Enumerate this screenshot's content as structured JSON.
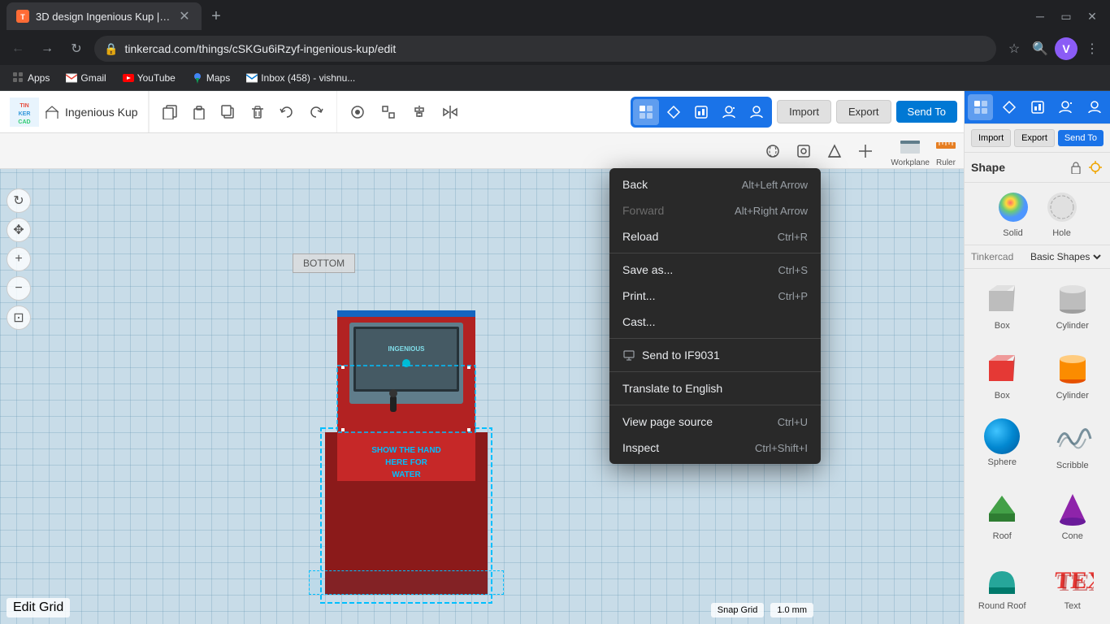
{
  "browser": {
    "tab": {
      "title": "3D design Ingenious Kup | Tinker...",
      "favicon": "🎨"
    },
    "url": "tinkercad.com/things/cSKGu6iRzyf-ingenious-kup/edit",
    "bookmarks": [
      {
        "label": "Apps",
        "icon": "grid"
      },
      {
        "label": "Gmail",
        "icon": "mail"
      },
      {
        "label": "YouTube",
        "icon": "youtube"
      },
      {
        "label": "Maps",
        "icon": "map"
      },
      {
        "label": "Inbox (458) - vishnu...",
        "icon": "mail"
      }
    ]
  },
  "tinkercad": {
    "project_name": "Ingenious Kup",
    "logo_letters": [
      "TIN",
      "KER",
      "CAD"
    ],
    "toolbar": {
      "copy_label": "Copy",
      "paste_label": "Paste",
      "duplicate_label": "Duplicate",
      "delete_label": "Delete",
      "undo_label": "Undo",
      "redo_label": "Redo"
    },
    "actions": {
      "import": "Import",
      "export": "Export",
      "send_to": "Send To"
    },
    "shape_panel": {
      "title": "Shape",
      "solid_label": "Solid",
      "hole_label": "Hole",
      "library_name": "Basic Shapes",
      "shapes": [
        {
          "name": "Box",
          "type": "box-gray"
        },
        {
          "name": "Cylinder",
          "type": "cyl-gray"
        },
        {
          "name": "Box",
          "type": "box-red"
        },
        {
          "name": "Cylinder",
          "type": "cyl-orange"
        },
        {
          "name": "Sphere",
          "type": "sphere-blue"
        },
        {
          "name": "Scribble",
          "type": "scribble"
        },
        {
          "name": "Roof",
          "type": "roof"
        },
        {
          "name": "Cone",
          "type": "cone"
        },
        {
          "name": "Round Roof",
          "type": "roundroof"
        },
        {
          "name": "Text",
          "type": "text-3d"
        }
      ]
    },
    "bottom": {
      "edit_grid": "Edit Grid",
      "snap_grid": "Snap Grid",
      "snap_value": "1.0 mm"
    }
  },
  "context_menu": {
    "items": [
      {
        "label": "Back",
        "shortcut": "Alt+Left Arrow",
        "enabled": true
      },
      {
        "label": "Forward",
        "shortcut": "Alt+Right Arrow",
        "enabled": false
      },
      {
        "label": "Reload",
        "shortcut": "Ctrl+R",
        "enabled": true
      },
      {
        "label": "Save as...",
        "shortcut": "Ctrl+S",
        "enabled": true
      },
      {
        "label": "Print...",
        "shortcut": "Ctrl+P",
        "enabled": true
      },
      {
        "label": "Cast...",
        "shortcut": "",
        "enabled": true
      },
      {
        "label": "Send to IF9031",
        "shortcut": "",
        "enabled": true,
        "special": true
      },
      {
        "label": "Translate to English",
        "shortcut": "",
        "enabled": true
      },
      {
        "label": "View page source",
        "shortcut": "Ctrl+U",
        "enabled": true
      },
      {
        "label": "Inspect",
        "shortcut": "Ctrl+Shift+I",
        "enabled": true
      }
    ]
  },
  "canvas": {
    "bottom_label": "BOTTOM",
    "object_text": "SHOW THE HAND\nHERE FOR\nWATER"
  }
}
